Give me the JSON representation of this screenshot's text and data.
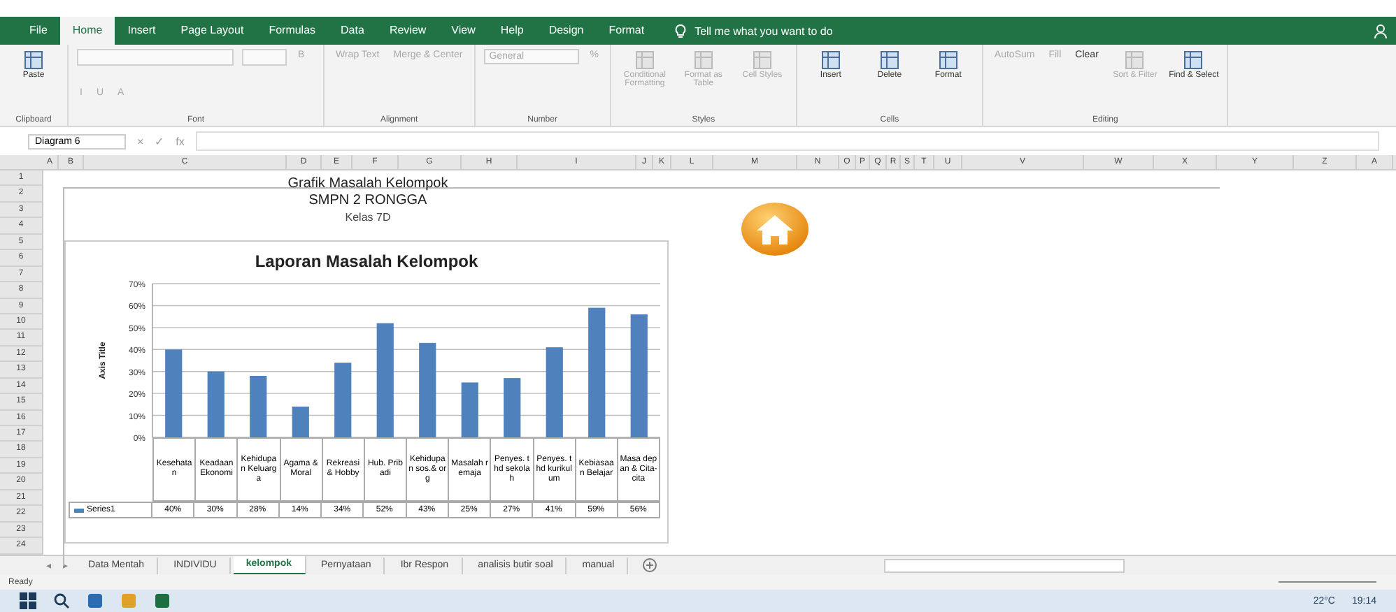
{
  "ribbon_tabs": [
    {
      "label": "File",
      "selected": false
    },
    {
      "label": "Home",
      "selected": true
    },
    {
      "label": "Insert",
      "selected": false
    },
    {
      "label": "Page Layout",
      "selected": false
    },
    {
      "label": "Formulas",
      "selected": false
    },
    {
      "label": "Data",
      "selected": false
    },
    {
      "label": "Review",
      "selected": false
    },
    {
      "label": "View",
      "selected": false
    },
    {
      "label": "Help",
      "selected": false
    },
    {
      "label": "Design",
      "selected": false
    },
    {
      "label": "Format",
      "selected": false
    }
  ],
  "tell_me": "Tell me what you want to do",
  "ribbon_groups": [
    {
      "name": "Clipboard",
      "commands": [
        {
          "label": "Paste",
          "kind": "large",
          "disabled": false
        }
      ]
    },
    {
      "name": "Font",
      "commands": [
        {
          "label": "B",
          "kind": "small",
          "disabled": true
        },
        {
          "label": "I",
          "kind": "small",
          "disabled": true
        },
        {
          "label": "U",
          "kind": "small",
          "disabled": true
        },
        {
          "label": "A",
          "kind": "small",
          "disabled": true
        }
      ]
    },
    {
      "name": "Alignment",
      "commands": [
        {
          "label": "Wrap Text",
          "kind": "small",
          "disabled": true
        },
        {
          "label": "Merge & Center",
          "kind": "small",
          "disabled": true
        }
      ]
    },
    {
      "name": "Number",
      "commands": [
        {
          "label": "General",
          "kind": "dropdown",
          "disabled": true
        },
        {
          "label": "%",
          "kind": "small",
          "disabled": true
        }
      ]
    },
    {
      "name": "Styles",
      "commands": [
        {
          "label": "Conditional Formatting",
          "kind": "large",
          "disabled": true
        },
        {
          "label": "Format as Table",
          "kind": "large",
          "disabled": true
        },
        {
          "label": "Cell Styles",
          "kind": "large",
          "disabled": true
        }
      ]
    },
    {
      "name": "Cells",
      "commands": [
        {
          "label": "Insert",
          "kind": "large",
          "disabled": false
        },
        {
          "label": "Delete",
          "kind": "large",
          "disabled": false
        },
        {
          "label": "Format",
          "kind": "large",
          "disabled": false
        }
      ]
    },
    {
      "name": "Editing",
      "commands": [
        {
          "label": "AutoSum",
          "kind": "small",
          "disabled": true
        },
        {
          "label": "Fill",
          "kind": "small",
          "disabled": true
        },
        {
          "label": "Clear",
          "kind": "small",
          "disabled": false
        },
        {
          "label": "Sort & Filter",
          "kind": "large",
          "disabled": true
        },
        {
          "label": "Find & Select",
          "kind": "large",
          "disabled": false
        }
      ]
    }
  ],
  "name_box": "Diagram 6",
  "formula_buttons": [
    "×",
    "✓",
    "fx"
  ],
  "columns": [
    "A",
    "B",
    "C",
    "D",
    "E",
    "F",
    "G",
    "H",
    "I",
    "J",
    "K",
    "L",
    "M",
    "N",
    "O",
    "P",
    "Q",
    "R",
    "S",
    "T",
    "U",
    "V",
    "W",
    "X",
    "Y",
    "Z",
    "A"
  ],
  "rows": [
    "1",
    "2",
    "3",
    "4",
    "5",
    "6",
    "7",
    "8",
    "9",
    "10",
    "11",
    "12",
    "13",
    "14",
    "15",
    "16",
    "17",
    "18",
    "19",
    "20",
    "21",
    "22",
    "23",
    "24"
  ],
  "sheet_titles": [
    "Grafik Masalah Kelompok",
    "SMPN 2 RONGGA",
    "Kelas 7D"
  ],
  "chart": {
    "chart_data": {
      "type": "bar",
      "title": "Laporan Masalah Kelompok",
      "ylabel": "Axis Title",
      "categories": [
        "Kesehatan",
        "Keadaan Ekonomi",
        "Kehidupan Keluarga",
        "Agama & Moral",
        "Rekreasi & Hobby",
        "Hub. Pribadi",
        "Kehidupan sos.& org",
        "Masalah remaja",
        "Penyes. thd sekolah",
        "Penyes. thd kurikulum",
        "Kebiasaan Belajar",
        "Masa depan & Cita-cita"
      ],
      "series": [
        {
          "name": "Series1",
          "color": "#4f81bd",
          "values": [
            0.4,
            0.3,
            0.28,
            0.14,
            0.34,
            0.52,
            0.43,
            0.25,
            0.27,
            0.41,
            0.59,
            0.56
          ]
        }
      ],
      "ylim": [
        0,
        0.7
      ],
      "grid": true,
      "yticks": [
        {
          "value": 0,
          "label": "0%"
        },
        {
          "value": 0.1,
          "label": "10%"
        },
        {
          "value": 0.2,
          "label": "20%"
        },
        {
          "value": 0.3,
          "label": "30%"
        },
        {
          "value": 0.4,
          "label": "40%"
        },
        {
          "value": 0.5,
          "label": "50%"
        },
        {
          "value": 0.6,
          "label": "60%"
        },
        {
          "value": 0.7,
          "label": "70%"
        }
      ],
      "value_labels": [
        "40%",
        "30%",
        "28%",
        "14%",
        "34%",
        "52%",
        "43%",
        "25%",
        "27%",
        "41%",
        "59%",
        "56%"
      ]
    }
  },
  "sheet_nav": [
    "◂",
    "▸"
  ],
  "sheet_tabs": [
    {
      "label": "Data Mentah",
      "selected": false
    },
    {
      "label": "INDIVIDU",
      "selected": false
    },
    {
      "label": "kelompok",
      "selected": true
    },
    {
      "label": "Pernyataan",
      "selected": false
    },
    {
      "label": "Ibr Respon",
      "selected": false
    },
    {
      "label": "analisis butir soal",
      "selected": false
    },
    {
      "label": "manual",
      "selected": false
    }
  ],
  "status": "Ready",
  "taskbar": {
    "weather": "22°C",
    "time": "19:14"
  }
}
